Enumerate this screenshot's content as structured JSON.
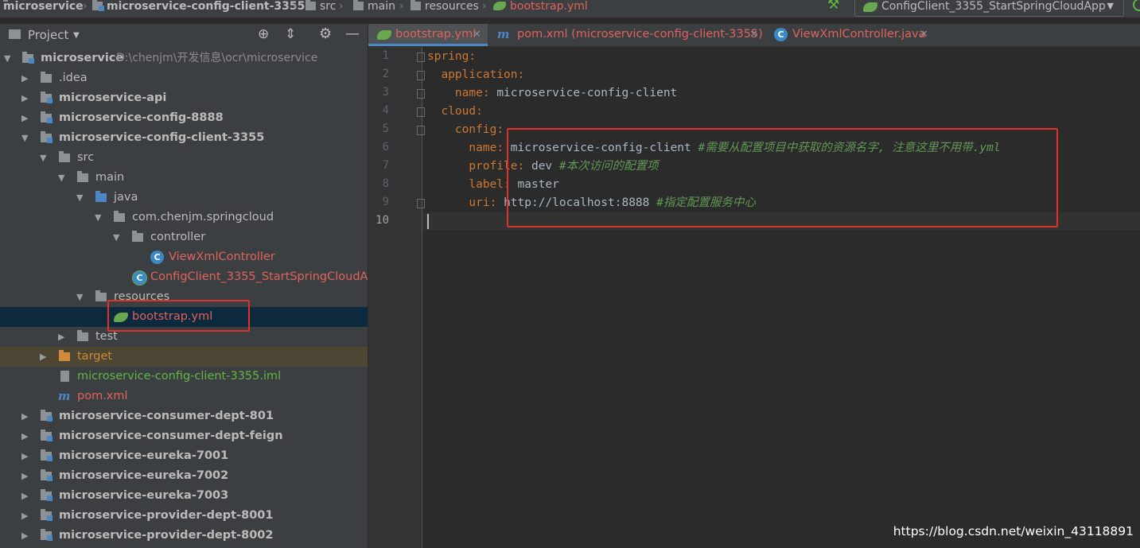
{
  "breadcrumbs": {
    "items": [
      "microservice",
      "microservice-config-client-3355",
      "src",
      "main",
      "resources",
      "bootstrap.yml"
    ]
  },
  "run_config": {
    "label": "ConfigClient_3355_StartSpringCloudApp"
  },
  "project_panel": {
    "title": "Project",
    "tree": [
      {
        "label": "microservice",
        "path": "D:\\chenjm\\开发信息\\ocr\\microservice"
      },
      {
        "label": ".idea"
      },
      {
        "label": "microservice-api"
      },
      {
        "label": "microservice-config-8888"
      },
      {
        "label": "microservice-config-client-3355"
      },
      {
        "label": "src"
      },
      {
        "label": "main"
      },
      {
        "label": "java"
      },
      {
        "label": "com.chenjm.springcloud"
      },
      {
        "label": "controller"
      },
      {
        "label": "ViewXmlController"
      },
      {
        "label": "ConfigClient_3355_StartSpringCloudApp"
      },
      {
        "label": "resources"
      },
      {
        "label": "bootstrap.yml"
      },
      {
        "label": "test"
      },
      {
        "label": "target"
      },
      {
        "label": "microservice-config-client-3355.iml"
      },
      {
        "label": "pom.xml"
      },
      {
        "label": "microservice-consumer-dept-801"
      },
      {
        "label": "microservice-consumer-dept-feign"
      },
      {
        "label": "microservice-eureka-7001"
      },
      {
        "label": "microservice-eureka-7002"
      },
      {
        "label": "microservice-eureka-7003"
      },
      {
        "label": "microservice-provider-dept-8001"
      },
      {
        "label": "microservice-provider-dept-8002"
      }
    ]
  },
  "editor": {
    "tabs": [
      {
        "label": "bootstrap.yml"
      },
      {
        "label": "pom.xml (microservice-config-client-3355)"
      },
      {
        "label": "ViewXmlController.java"
      }
    ],
    "line_numbers": [
      "1",
      "2",
      "3",
      "4",
      "5",
      "6",
      "7",
      "8",
      "9",
      "10"
    ],
    "lines": [
      {
        "key": "spring",
        "value": "",
        "comment": ""
      },
      {
        "key": "application",
        "value": "",
        "comment": ""
      },
      {
        "key": "name",
        "value": "microservice-config-client",
        "comment": ""
      },
      {
        "key": "cloud",
        "value": "",
        "comment": ""
      },
      {
        "key": "config",
        "value": "",
        "comment": ""
      },
      {
        "key": "name",
        "value": "microservice-config-client",
        "comment": "#需要从配置项目中获取的资源名字, 注意这里不用带.yml"
      },
      {
        "key": "profile",
        "value": "dev",
        "comment": "#本次访问的配置项"
      },
      {
        "key": "label",
        "value": "master",
        "comment": ""
      },
      {
        "key": "uri",
        "value": "http://localhost:8888",
        "comment": "#指定配置服务中心"
      }
    ]
  },
  "watermark": "https://blog.csdn.net/weixin_43118891",
  "colors": {
    "highlight_box": "#e0302a",
    "selected_row": "#0d293e",
    "target_row": "#4d4633",
    "yaml_key": "#cc7832",
    "yaml_comment": "#629755",
    "red_file": "#e0625c",
    "green_file": "#62b543"
  }
}
